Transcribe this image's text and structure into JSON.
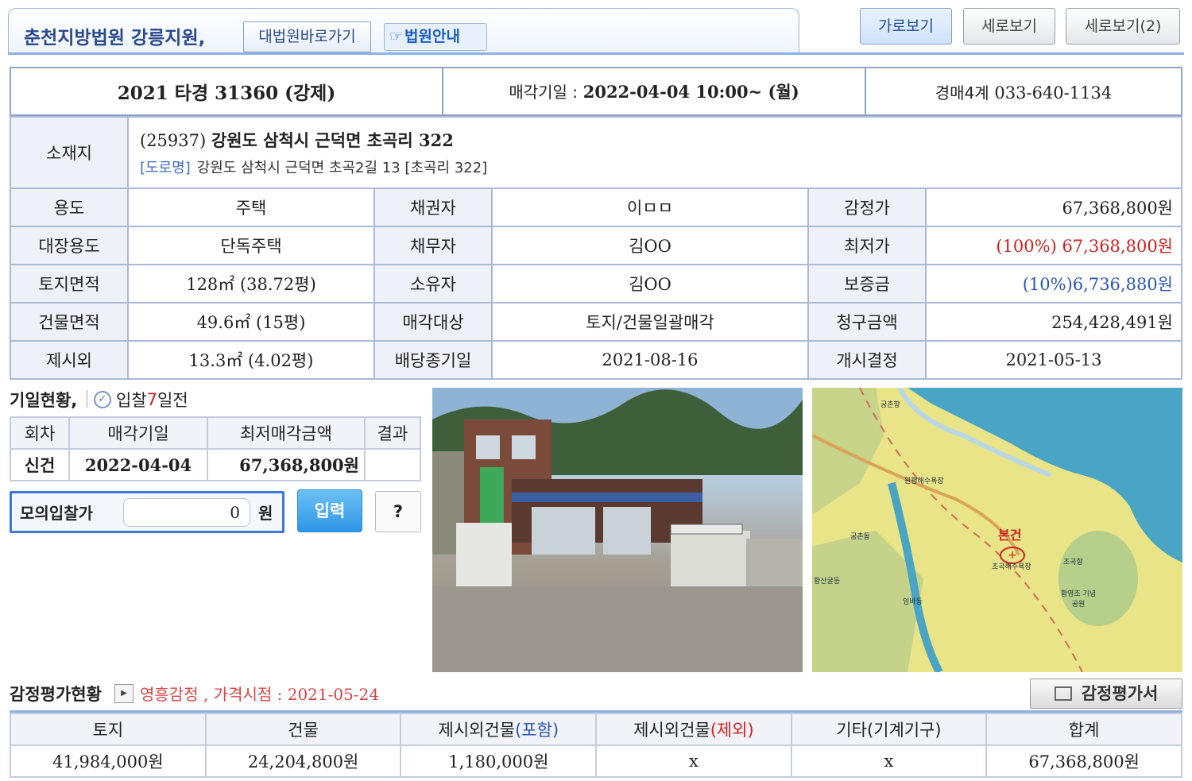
{
  "header": {
    "court_name": "춘천지방법원 강릉지원,",
    "court_link": "대법원바로가기",
    "court_guide": "법원안내",
    "views": [
      "가로보기",
      "세로보기",
      "세로보기(2)"
    ]
  },
  "case": {
    "number": "2021 타경 31360 (강제)",
    "sale_date_label": "매각기일 :",
    "sale_date_value": "2022-04-04 10:00~ (월)",
    "dept_name": "경매4계",
    "dept_phone": "033-640-1134"
  },
  "address": {
    "label": "소재지",
    "zip": "(25937)",
    "main": "강원도 삼척시 근덕면 초곡리 322",
    "road_tag": "[도로명]",
    "road": "강원도 삼척시 근덕면 초곡2길 13 [초곡리 322]"
  },
  "details": [
    [
      {
        "k": "용도",
        "v": "주택"
      },
      {
        "k": "채권자",
        "v": "이ㅁㅁ"
      },
      {
        "k": "감정가",
        "v": "67,368,800원"
      }
    ],
    [
      {
        "k": "대장용도",
        "v": "단독주택"
      },
      {
        "k": "채무자",
        "v": "김OO"
      },
      {
        "k": "최저가",
        "v": "(100%) 67,368,800원"
      }
    ],
    [
      {
        "k": "토지면적",
        "v": "128㎡ (38.72평)"
      },
      {
        "k": "소유자",
        "v": "김OO"
      },
      {
        "k": "보증금",
        "v": "(10%)6,736,880원"
      }
    ],
    [
      {
        "k": "건물면적",
        "v": "49.6㎡ (15평)"
      },
      {
        "k": "매각대상",
        "v": "토지/건물일괄매각"
      },
      {
        "k": "청구금액",
        "v": "254,428,491원"
      }
    ],
    [
      {
        "k": "제시외",
        "v": "13.3㎡ (4.02평)"
      },
      {
        "k": "배당종기일",
        "v": "2021-08-16"
      },
      {
        "k": "개시결정",
        "v": "2021-05-13"
      }
    ]
  ],
  "schedule": {
    "title": "기일현황,",
    "bid_prefix": "입찰",
    "bid_days": "7",
    "bid_suffix": "일전",
    "headers": [
      "회차",
      "매각기일",
      "최저매각금액",
      "결과"
    ],
    "row": [
      "신건",
      "2022-04-04",
      "67,368,800원",
      ""
    ]
  },
  "mock_bid": {
    "label": "모의입찰가",
    "value": "0",
    "unit": "원",
    "submit": "입력",
    "help": "?"
  },
  "map": {
    "labels": [
      "궁촌항",
      "원평해수욕장",
      "궁촌동",
      "황산굴등",
      "임바등",
      "본건",
      "초곡해수욕장",
      "초곡항",
      "황영조 기념공원"
    ]
  },
  "appraisal": {
    "title": "감정평가현황",
    "info": "영흥감정 , 가격시점 : 2021-05-24",
    "doc_button": "감정평가서",
    "headers": [
      "토지",
      "건물",
      "제시외건물",
      "제시외건물",
      "기타(기계기구)",
      "합계"
    ],
    "header_suffix_include": "(포함)",
    "header_suffix_exclude": "(제외)",
    "values": [
      "41,984,000원",
      "24,204,800원",
      "1,180,000원",
      "x",
      "x",
      "67,368,800원"
    ]
  },
  "colors": {
    "accent": "#3d78d8",
    "header_text": "#2a4a8c",
    "red": "#d02020",
    "blue": "#2a55b8"
  }
}
